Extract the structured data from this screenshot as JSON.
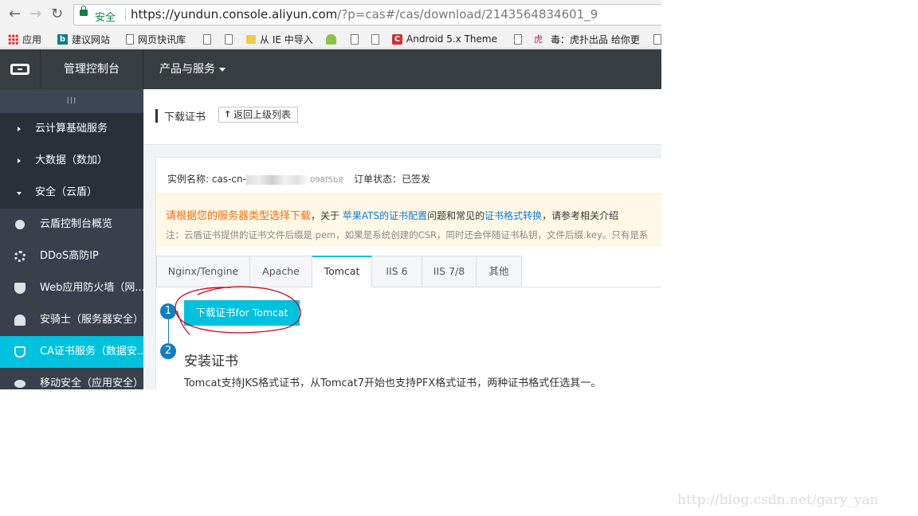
{
  "browser": {
    "secure_label": "安全",
    "url_host": "https://yundun.console.aliyun.com",
    "url_path": "/?p=cas#/cas/download/2143564834601_9",
    "bookmarks": [
      {
        "label": "应用",
        "icon": "apps-grid-icon"
      },
      {
        "label": "建议网站",
        "icon": "bing-icon"
      },
      {
        "label": "网页快讯库",
        "icon": "page-icon"
      },
      {
        "label": "",
        "icon": "page-icon"
      },
      {
        "label": "",
        "icon": "page-icon"
      },
      {
        "label": "从 IE 中导入",
        "icon": "folder-icon"
      },
      {
        "label": "",
        "icon": "android-icon"
      },
      {
        "label": "",
        "icon": "page-icon"
      },
      {
        "label": "",
        "icon": "page-icon"
      },
      {
        "label": "Android 5.x Theme",
        "icon": "red-c-icon"
      },
      {
        "label": "",
        "icon": "page-icon"
      },
      {
        "label": "毒：虎扑出品 给你更",
        "icon": "tiger-icon"
      },
      {
        "label": "",
        "icon": "page-icon"
      }
    ]
  },
  "header": {
    "console_title": "管理控制台",
    "products_label": "产品与服务"
  },
  "sidebar": {
    "collapse_glyph": "III",
    "groups": [
      {
        "label": "云计算基础服务"
      },
      {
        "label": "大数据（数加）"
      },
      {
        "label": "安全（云盾）"
      }
    ],
    "items": [
      {
        "label": "云盾控制台概览",
        "icon": "dot-icon"
      },
      {
        "label": "DDoS高防IP",
        "icon": "gear-icon"
      },
      {
        "label": "Web应用防火墙（网...",
        "icon": "shield-icon"
      },
      {
        "label": "安骑士（服务器安全）",
        "icon": "knight-icon"
      },
      {
        "label": "CA证书服务（数据安...",
        "icon": "cert-icon"
      },
      {
        "label": "移动安全（应用安全）",
        "icon": "eye-icon"
      }
    ]
  },
  "page": {
    "title": "下载证书",
    "back_button": "返回上级列表",
    "instance_label": "实例名称: cas-cn-",
    "instance_tail": "098f5b8",
    "order_status": "订单状态：已签发",
    "notice_part1": "请根据您的服务器类型选择下载",
    "notice_part2": "，关于",
    "notice_link1": "苹果ATS的证书配置",
    "notice_part3": "问题和常见的",
    "notice_link2": "证书格式转换",
    "notice_part4": "，请参考相关介绍",
    "note": "注：云盾证书提供的证书文件后缀是.pem，如果是系统创建的CSR，同时还会伴随证书私钥，文件后缀.key。只有是系",
    "tabs": [
      "Nginx/Tengine",
      "Apache",
      "Tomcat",
      "IIS 6",
      "IIS 7/8",
      "其他"
    ],
    "active_tab": "Tomcat",
    "step1_num": "1",
    "download_button": "下载证书for Tomcat",
    "step2_num": "2",
    "step2_title": "安装证书",
    "step2_desc": "Tomcat支持JKS格式证书，从Tomcat7开始也支持PFX格式证书，两种证书格式任选其一。"
  },
  "watermark": "http://blog.csdn.net/gary_yan",
  "colors": {
    "accent": "#00c1de",
    "header_bg": "#373d41",
    "sidebar_bg": "#293038",
    "notice_orange": "#f56d0f",
    "link_blue": "#0f7cd1",
    "step_blue": "#0e7fbf",
    "annotation_red": "#d0021b"
  }
}
